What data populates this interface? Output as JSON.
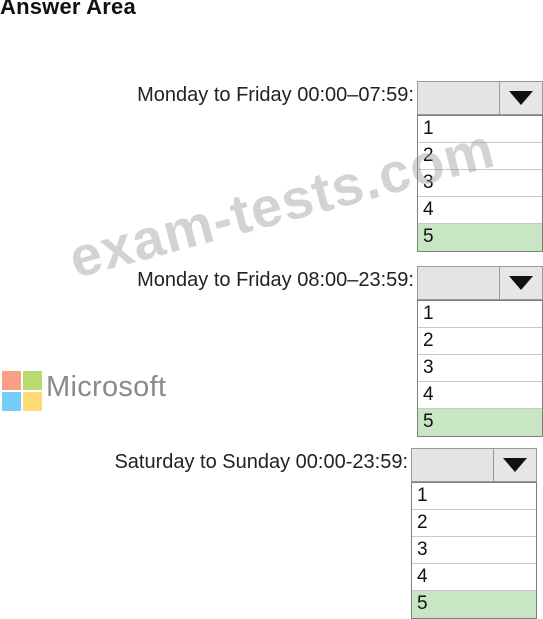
{
  "title": "Answer Area",
  "rows": [
    {
      "label": "Monday to Friday 00:00–07:59:",
      "options": [
        "1",
        "2",
        "3",
        "4",
        "5"
      ],
      "selected": "5"
    },
    {
      "label": "Monday to Friday 08:00–23:59:",
      "options": [
        "1",
        "2",
        "3",
        "4",
        "5"
      ],
      "selected": "5"
    },
    {
      "label": "Saturday to Sunday 00:00-23:59:",
      "options": [
        "1",
        "2",
        "3",
        "4",
        "5"
      ],
      "selected": "5"
    }
  ],
  "logo": {
    "text": "Microsoft",
    "colors": [
      "#f25022",
      "#7fba00",
      "#00a4ef",
      "#ffb900"
    ]
  },
  "watermark": "exam-tests.com",
  "colors": {
    "selected_option": "#c8e6c4",
    "dropdown_bg": "#e4e4e4"
  },
  "icons": {
    "dropdown_arrow": "triangle-down-icon"
  }
}
